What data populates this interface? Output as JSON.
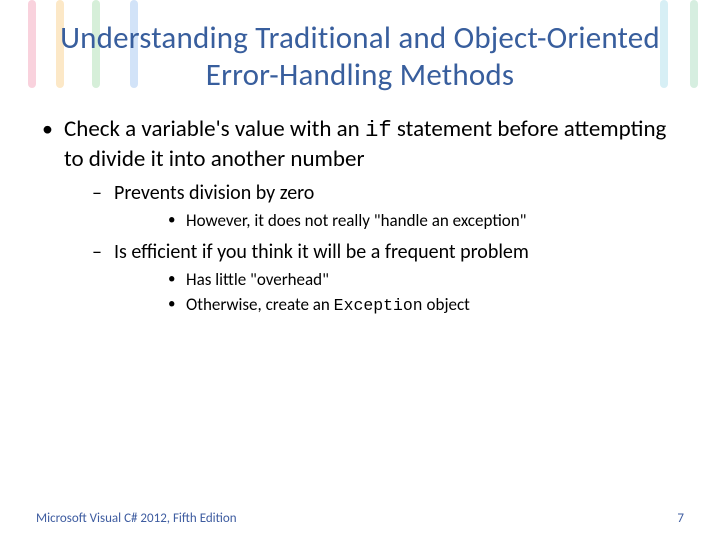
{
  "title": "Understanding Traditional and Object-Oriented Error-Handling Methods",
  "bullets": {
    "l1_a_pre": "Check a variable's value with an ",
    "l1_a_code": "if",
    "l1_a_post": " statement before attempting to divide it into another number",
    "l2_a": "Prevents division by zero",
    "l3_a": "However, it does not really \"handle an exception\"",
    "l2_b": "Is efficient if you think it will be a frequent problem",
    "l3_b": "Has little \"overhead\"",
    "l3_c_pre": "Otherwise, create an ",
    "l3_c_code": "Exception",
    "l3_c_post": " object"
  },
  "footer": {
    "text": "Microsoft Visual C# 2012, Fifth Edition",
    "page": "7"
  }
}
